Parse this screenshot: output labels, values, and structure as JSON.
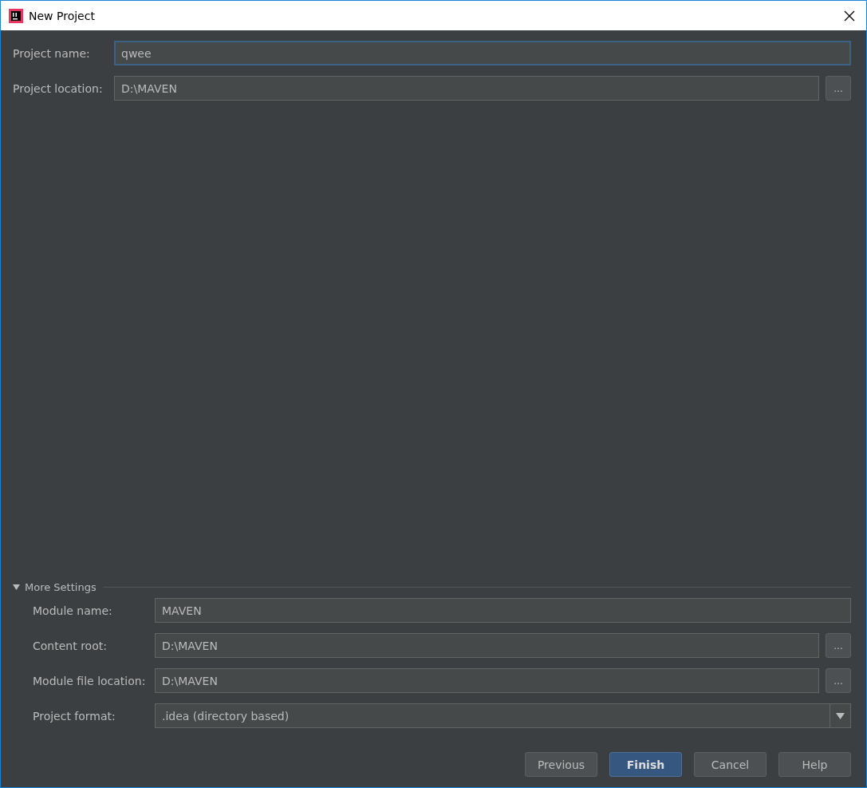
{
  "window": {
    "title": "New Project"
  },
  "project_fields": [
    {
      "label": "Project name:",
      "kind": "text",
      "value": "qwee",
      "focused": true
    },
    {
      "label": "Project location:",
      "kind": "browse",
      "value": "D:\\MAVEN",
      "focused": false,
      "browse_label": "..."
    }
  ],
  "more_settings": {
    "label": "More Settings",
    "expanded": true,
    "fields": [
      {
        "label": "Module name:",
        "kind": "text",
        "value": "MAVEN",
        "focused": false
      },
      {
        "label": "Content root:",
        "kind": "browse",
        "value": "D:\\MAVEN",
        "focused": false,
        "browse_label": "..."
      },
      {
        "label": "Module file location:",
        "kind": "browse",
        "value": "D:\\MAVEN",
        "focused": false,
        "browse_label": "..."
      },
      {
        "label": "Project format:",
        "kind": "dropdown",
        "value": ".idea (directory based)",
        "focused": false
      }
    ]
  },
  "buttons": [
    {
      "label": "Previous",
      "default": false
    },
    {
      "label": "Finish",
      "default": true
    },
    {
      "label": "Cancel",
      "default": false
    },
    {
      "label": "Help",
      "default": false
    }
  ]
}
